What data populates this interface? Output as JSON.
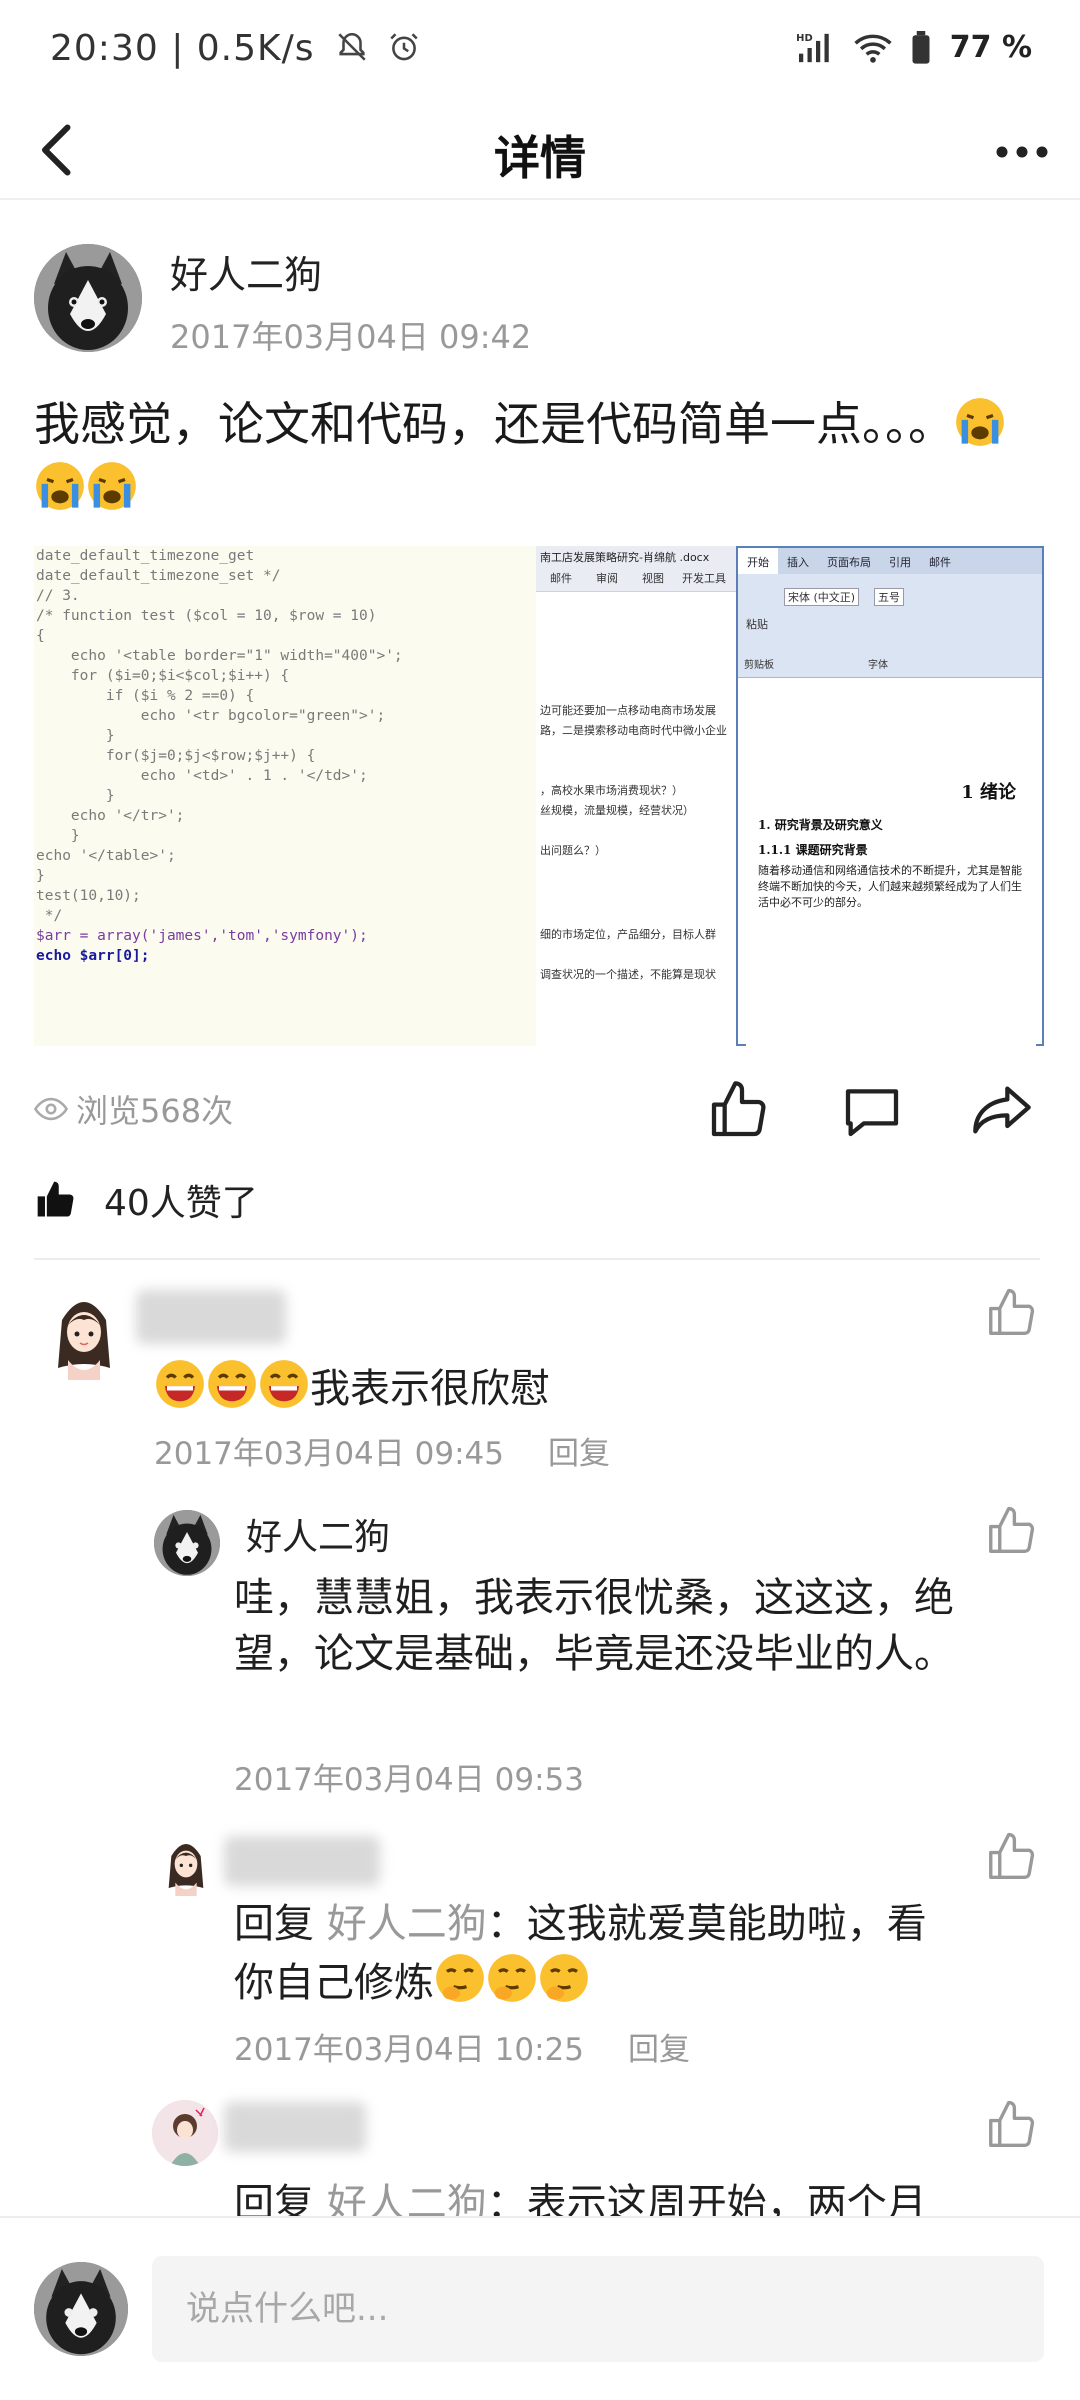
{
  "status": {
    "time": "20:30 | 0.5K/s",
    "battery": "77",
    "battery_suffix": "%"
  },
  "nav": {
    "title": "详情"
  },
  "post": {
    "author": "好人二狗",
    "time": "2017年03月04日 09:42",
    "text_line1": "我感觉，论文和代码，还是代码简单一点。。。",
    "views": "浏览568次",
    "likes": "40人赞了"
  },
  "image": {
    "code_lines": [
      "date_default_timezone_get",
      "date_default_timezone_set */",
      "// 3.",
      "",
      "/* function test ($col = 10, $row = 10)",
      "{",
      "    echo '<table border=\"1\" width=\"400\">';",
      "    for ($i=0;$i<$col;$i++) {",
      "        if ($i % 2 ==0) {",
      "            echo '<tr bgcolor=\"green\">';",
      "",
      "        }",
      "        for($j=0;$j<$row;$j++) {",
      "            echo '<td>' . 1 . '</td>';",
      "",
      "        }",
      "    echo '</tr>';",
      "    }",
      "echo '</table>';",
      "}",
      "test(10,10);",
      "",
      " */",
      "$arr = array('james','tom','symfony');",
      "echo $arr[0];"
    ],
    "doc_title_bar": "南工店发展策略研究-肖绵航 .docx",
    "doc_menu": [
      "邮件",
      "审阅",
      "视图",
      "开发工具"
    ],
    "doc_left_lines": [
      "边可能还要加一点移动电商市场发展",
      "路，二是摸索移动电商时代中微小企业",
      "，高校水果市场消费现状？）",
      "丝规模，流量规模，经营状况）",
      "出问题么？）",
      "细的市场定位，产品细分，目标人群",
      "调查状况的一个描述，不能算是现状"
    ],
    "word_tabs": [
      "开始",
      "插入",
      "页面布局",
      "引用",
      "邮件"
    ],
    "word_font": "宋体 (中文正)",
    "word_size": "五号",
    "word_clipboard": "剪贴板",
    "word_font_group": "字体",
    "word_paste": "粘贴",
    "word_h1": "1 绪论",
    "word_h2": "1.  研究背景及研究意义",
    "word_h3": "1.1.1   课题研究背景",
    "word_p": "随着移动通信和网络通信技术的不断提升，尤其是智能终端不断加快的今天，人们越来越频繁经成为了人们生活中必不可少的部分。"
  },
  "comments": [
    {
      "text": "我表示很欣慰",
      "time": "2017年03月04日 09:45",
      "reply_label": "回复"
    },
    {
      "author": "好人二狗",
      "text": " 哇，慧慧姐，我表示很忧桑，这这这，绝望，论文是基础，毕竟是还没毕业的人。",
      "time": "2017年03月04日 09:53"
    },
    {
      "reply_prefix": " 回复 ",
      "reply_target": "好人二狗",
      "text": "：这我就爱莫能助啦，看你自己修炼",
      "time": "2017年03月04日 10:25",
      "reply_label": "回复"
    },
    {
      "reply_prefix": " 回复 ",
      "reply_target": "好人二狗",
      "text": "：表示这周开始，两个月"
    }
  ],
  "input": {
    "placeholder": "说点什么吧..."
  },
  "colors": {
    "accent": "#222222",
    "muted": "#999999",
    "divider": "#ececec",
    "input_bg": "#f4f4f4"
  }
}
